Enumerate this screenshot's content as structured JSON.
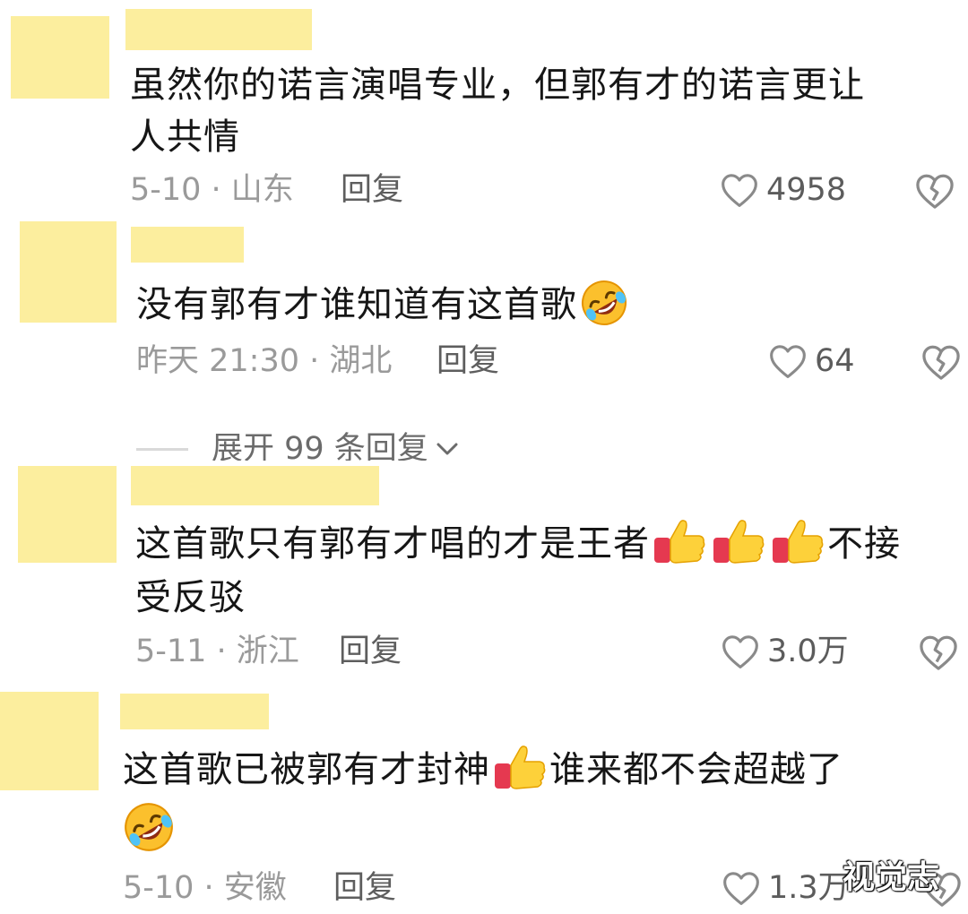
{
  "icons": {
    "like": "heart-outline-icon",
    "dislike": "broken-heart-icon",
    "laugh": "rolling-on-floor-laughing-emoji",
    "thumb": "thumbs-up-emoji",
    "chevron": "chevron-down-icon"
  },
  "colors": {
    "redacted": "#fcee9e",
    "text": "#161616",
    "meta": "#9a9a9a"
  },
  "comments": [
    {
      "line1": "虽然你的诺言演唱专业，但郭有才的诺言更让",
      "line2": "人共情",
      "meta": "5-10 · 山东",
      "reply": "回复",
      "likes": "4958"
    },
    {
      "line1": "没有郭有才谁知道有这首歌",
      "meta": "昨天 21:30 · 湖北",
      "reply": "回复",
      "likes": "64"
    },
    {
      "line1a": "这首歌只有郭有才唱的才是王者",
      "line1b": "不接",
      "line2": "受反驳",
      "meta": "5-11 · 浙江",
      "reply": "回复",
      "likes": "3.0万"
    },
    {
      "line1a": "这首歌已被郭有才封神",
      "line1b": "谁来都不会超越了",
      "meta": "5-10 · 安徽",
      "reply": "回复",
      "likes": "1.3万"
    }
  ],
  "expand_replies": "展开 99 条回复",
  "watermark": "视觉志"
}
